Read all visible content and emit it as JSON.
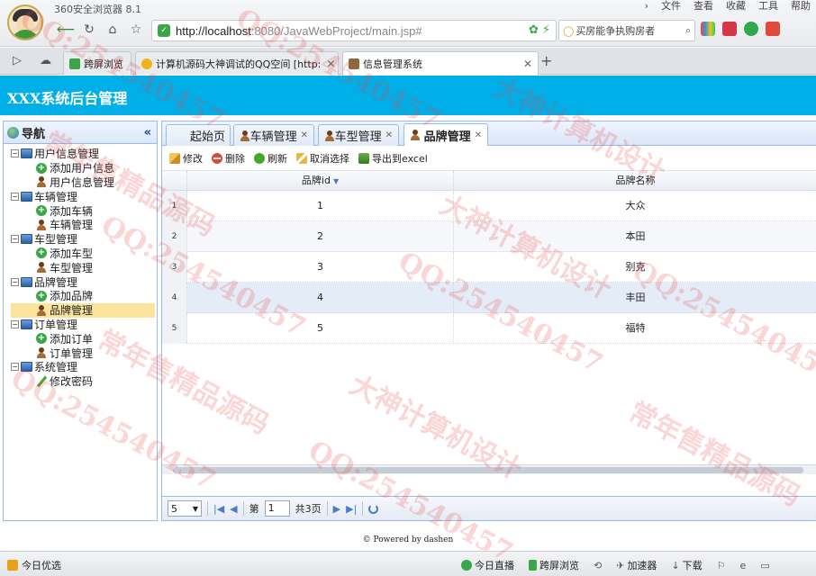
{
  "browser": {
    "name": "360安全浏览器 8.1",
    "menu": [
      "文件",
      "查看",
      "收藏",
      "工具",
      "帮助"
    ],
    "url_host": "http://localhost",
    "url_rest": ":8080/JavaWebProject/main.jsp#",
    "search_text": "买房能争执购房者",
    "tabs": [
      {
        "label": "跨屏浏览",
        "icon_color": "#3aa648"
      },
      {
        "label": "计算机源码大神调试的QQ空间 [http:",
        "icon_color": "#f2b21b"
      },
      {
        "label": "信息管理系统",
        "icon_color": "#8a6a3a"
      }
    ],
    "new_tab": "+"
  },
  "app": {
    "title": "XXX系统后台管理"
  },
  "sidebar": {
    "title": "导航",
    "collapse": "«",
    "groups": [
      {
        "label": "用户信息管理",
        "items": [
          {
            "label": "添加用户信息",
            "icon": "plus-icon"
          },
          {
            "label": "用户信息管理",
            "icon": "user-icon"
          }
        ]
      },
      {
        "label": "车辆管理",
        "items": [
          {
            "label": "添加车辆",
            "icon": "plus-icon"
          },
          {
            "label": "车辆管理",
            "icon": "user-icon"
          }
        ]
      },
      {
        "label": "车型管理",
        "items": [
          {
            "label": "添加车型",
            "icon": "plus-icon"
          },
          {
            "label": "车型管理",
            "icon": "user-icon"
          }
        ]
      },
      {
        "label": "品牌管理",
        "items": [
          {
            "label": "添加品牌",
            "icon": "plus-icon"
          },
          {
            "label": "品牌管理",
            "icon": "user-icon",
            "selected": true
          }
        ]
      },
      {
        "label": "订单管理",
        "items": [
          {
            "label": "添加订单",
            "icon": "plus-icon"
          },
          {
            "label": "订单管理",
            "icon": "user-icon"
          }
        ]
      },
      {
        "label": "系统管理",
        "items": [
          {
            "label": "修改密码",
            "icon": "pencil-icon"
          }
        ]
      }
    ]
  },
  "main": {
    "tabs": [
      {
        "label": "起始页",
        "closable": false
      },
      {
        "label": "车辆管理",
        "closable": true
      },
      {
        "label": "车型管理",
        "closable": true
      },
      {
        "label": "品牌管理",
        "closable": true,
        "active": true
      }
    ],
    "toolbar": [
      "修改",
      "删除",
      "刷新",
      "取消选择",
      "导出到excel"
    ],
    "grid": {
      "columns": [
        "品牌id",
        "品牌名称"
      ],
      "rows": [
        {
          "n": "1",
          "id": "1",
          "name": "大众"
        },
        {
          "n": "2",
          "id": "2",
          "name": "本田"
        },
        {
          "n": "3",
          "id": "3",
          "name": "别克"
        },
        {
          "n": "4",
          "id": "4",
          "name": "丰田"
        },
        {
          "n": "5",
          "id": "5",
          "name": "福特"
        }
      ]
    },
    "pager": {
      "page_size": "5",
      "page_prefix": "第",
      "page_value": "1",
      "page_suffix": "共3页"
    }
  },
  "footer": "Powered by dashen",
  "statusbar": {
    "left": "今日优选",
    "right": [
      "今日直播",
      "跨屏浏览",
      "加速器",
      "下载"
    ]
  },
  "watermarks": [
    "QQ:254540457",
    "大神计算机设计",
    "常年售精品源码"
  ]
}
